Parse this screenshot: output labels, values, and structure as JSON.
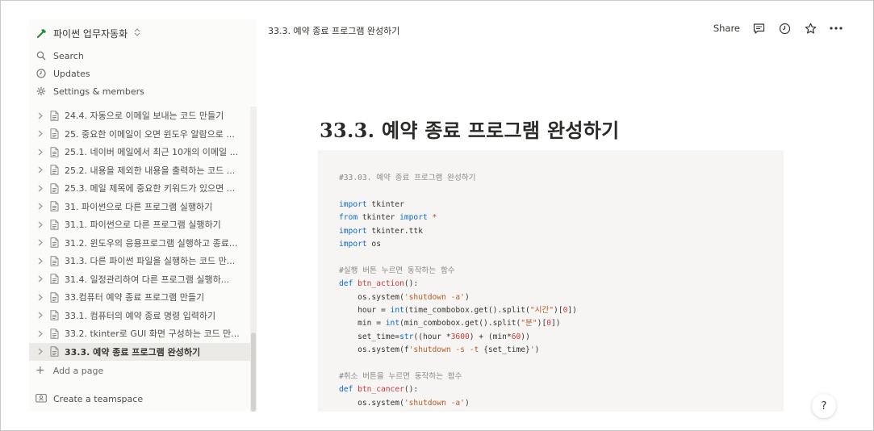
{
  "workspace": {
    "name": "파이썬 업무자동화",
    "chevron": "⌃⌄"
  },
  "nav": [
    {
      "icon": "search-icon",
      "label": "Search"
    },
    {
      "icon": "clock-icon",
      "label": "Updates"
    },
    {
      "icon": "gear-icon",
      "label": "Settings & members"
    }
  ],
  "tree": [
    {
      "label": "24.4. 자동으로 이메일 보내는 코드 만들기",
      "active": false
    },
    {
      "label": "25. 중요한 이메일이 오면 윈도우 알람으로 ...",
      "active": false
    },
    {
      "label": "25.1. 네이버 메일에서 최근 10개의 이메일 ...",
      "active": false
    },
    {
      "label": "25.2. 내용을 제외한 내용을 출력하는 코드 ...",
      "active": false
    },
    {
      "label": "25.3. 메일 제목에 중요한 키워드가 있으면 ...",
      "active": false
    },
    {
      "label": "31. 파이썬으로 다른 프로그램 실행하기",
      "active": false
    },
    {
      "label": "31.1. 파이썬으로 다른 프로그램 실행하기",
      "active": false
    },
    {
      "label": "31.2. 윈도우의 응용프로그램 실행하고 종료...",
      "active": false
    },
    {
      "label": "31.3. 다른 파이썬 파일을 실행하는 코드 만...",
      "active": false
    },
    {
      "label": "31.4. 일정관리하여 다른 프로그램 실행하...",
      "active": false
    },
    {
      "label": "33.컴퓨터 예약 종료 프로그램 만들기",
      "active": false
    },
    {
      "label": "33.1. 컴퓨터의 예약 종료 명령 입력하기",
      "active": false
    },
    {
      "label": "33.2. tkinter로 GUI 화면 구성하는 코드 만...",
      "active": false
    },
    {
      "label": "33.3. 예약 종료 프로그램 완성하기",
      "active": true
    }
  ],
  "add_page": "Add a page",
  "create_teamspace": "Create a teamspace",
  "topbar": {
    "breadcrumb": "33.3. 예약 종료 프로그램 완성하기",
    "share": "Share"
  },
  "page": {
    "title": "33.3. 예약 종료 프로그램 완성하기"
  },
  "code_lines": [
    [
      {
        "t": "com",
        "v": "#33.03. 예약 종료 프로그램 완성하기"
      }
    ],
    [],
    [
      {
        "t": "kw",
        "v": "import"
      },
      {
        "t": "plain",
        "v": " tkinter"
      }
    ],
    [
      {
        "t": "kw",
        "v": "from"
      },
      {
        "t": "plain",
        "v": " tkinter "
      },
      {
        "t": "kw",
        "v": "import"
      },
      {
        "t": "plain",
        "v": " "
      },
      {
        "t": "fn",
        "v": "*"
      }
    ],
    [
      {
        "t": "kw",
        "v": "import"
      },
      {
        "t": "plain",
        "v": " tkinter.ttk"
      }
    ],
    [
      {
        "t": "kw",
        "v": "import"
      },
      {
        "t": "plain",
        "v": " os"
      }
    ],
    [],
    [
      {
        "t": "com",
        "v": "#실행 버튼 누르면 동작하는 함수"
      }
    ],
    [
      {
        "t": "kw",
        "v": "def"
      },
      {
        "t": "plain",
        "v": " "
      },
      {
        "t": "fn",
        "v": "btn_action"
      },
      {
        "t": "plain",
        "v": "():"
      }
    ],
    [
      {
        "t": "plain",
        "v": "    os.system("
      },
      {
        "t": "str",
        "v": "'shutdown -a'"
      },
      {
        "t": "plain",
        "v": ")"
      }
    ],
    [
      {
        "t": "plain",
        "v": "    hour = "
      },
      {
        "t": "kw",
        "v": "int"
      },
      {
        "t": "plain",
        "v": "(time_combobox.get().split("
      },
      {
        "t": "str",
        "v": "\"시간\""
      },
      {
        "t": "plain",
        "v": ")["
      },
      {
        "t": "num",
        "v": "0"
      },
      {
        "t": "plain",
        "v": "])"
      }
    ],
    [
      {
        "t": "plain",
        "v": "    min = "
      },
      {
        "t": "kw",
        "v": "int"
      },
      {
        "t": "plain",
        "v": "(min_combobox.get().split("
      },
      {
        "t": "str",
        "v": "\"분\""
      },
      {
        "t": "plain",
        "v": ")["
      },
      {
        "t": "num",
        "v": "0"
      },
      {
        "t": "plain",
        "v": "])"
      }
    ],
    [
      {
        "t": "plain",
        "v": "    set_time="
      },
      {
        "t": "kw",
        "v": "str"
      },
      {
        "t": "plain",
        "v": "((hour *"
      },
      {
        "t": "num",
        "v": "3600"
      },
      {
        "t": "plain",
        "v": ") + (min*"
      },
      {
        "t": "num",
        "v": "60"
      },
      {
        "t": "plain",
        "v": "))"
      }
    ],
    [
      {
        "t": "plain",
        "v": "    os.system(f"
      },
      {
        "t": "str",
        "v": "'shutdown -s -t "
      },
      {
        "t": "plain",
        "v": "{set_time}"
      },
      {
        "t": "str",
        "v": "'"
      },
      {
        "t": "plain",
        "v": ")"
      }
    ],
    [],
    [
      {
        "t": "com",
        "v": "#취소 버튼을 누르면 동작하는 함수"
      }
    ],
    [
      {
        "t": "kw",
        "v": "def"
      },
      {
        "t": "plain",
        "v": " "
      },
      {
        "t": "fn",
        "v": "btn_cancer"
      },
      {
        "t": "plain",
        "v": "():"
      }
    ],
    [
      {
        "t": "plain",
        "v": "    os.system("
      },
      {
        "t": "str",
        "v": "'shutdown -a'"
      },
      {
        "t": "plain",
        "v": ")"
      }
    ]
  ],
  "help": "?",
  "colors": {
    "sidebar_bg": "#fbfbfa",
    "code_bg": "#f6f5f3",
    "keyword": "#0b6bcb",
    "function": "#c93b3b",
    "string": "#b35c27",
    "comment": "#8a8985",
    "logo_green": "#2e8b3d"
  }
}
